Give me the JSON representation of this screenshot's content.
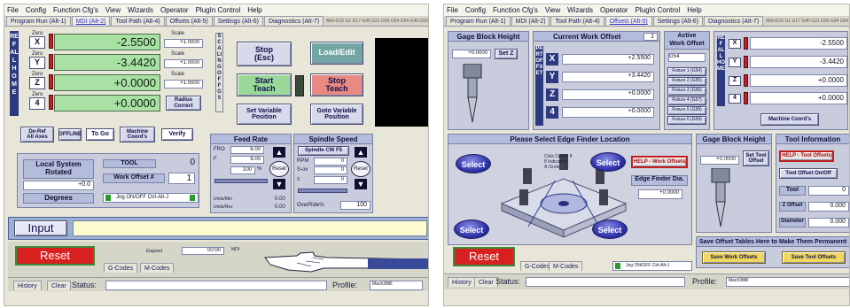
{
  "menu": [
    "File",
    "Config",
    "Function Cfg's",
    "View",
    "Wizards",
    "Operator",
    "PlugIn Control",
    "Help"
  ],
  "left": {
    "tabs": [
      "Program Run (Alt-1)",
      "MDI (Alt-2)",
      "Tool Path (Alt-4)",
      "Offsets (Alt-5)",
      "Settings (Alt-6)",
      "Diagnostics (Alt-7)"
    ],
    "tab_info": "Mill>G15 G1 G17 G40 G21 G90 G94 G54 G49 G99 G64 G97",
    "ref_all_home": "REF ALL HOME",
    "axes": [
      {
        "btn": "X",
        "value": "-2.5500",
        "scale_label": "Scale",
        "scale_value": "+1.0000"
      },
      {
        "btn": "Y",
        "value": "-3.4420",
        "scale_label": "Scale",
        "scale_value": "+1.0000"
      },
      {
        "btn": "Z",
        "value": "+0.0000",
        "scale_label": "Scale",
        "scale_value": "+1.0000"
      },
      {
        "btn": "4",
        "value": "+0.0000",
        "scale_label": "Radius",
        "scale_value": "Correct"
      }
    ],
    "zero_label": "Zero",
    "scaling_offs": "SCALING OFF G5",
    "stop": "Stop\n(Esc)",
    "load_edit": "Load/Edit",
    "start_teach": "Start\nTeach",
    "stop_teach": "Stop\nTeach",
    "set_variable_position": "Set Variable\nPosition",
    "goto_variable_position": "Goto Variable\nPosition",
    "de_ref": "De-Ref\nAll Axes",
    "offline": "OFFLINE",
    "to_go": "To Go",
    "machine_coords": "Machine\nCoord's",
    "verify": "Verify",
    "local_system_rotated": "Local System\nRotated",
    "rotated_value": "+0.0",
    "degrees": "Degrees",
    "tool_label": "TOOL",
    "tool_value": "0",
    "work_offset_label": "Work Offset #",
    "work_offset_value": "1",
    "jog_toggle": "Jog ON/OFF Ctrl-Alt-J",
    "feed_rate_title": "Feed Rate",
    "fro_label": "FRO",
    "fro_value": "6.00",
    "f_label": "F",
    "f_value": "6.00",
    "fro_percent": "100",
    "reset_small": "Reset",
    "units_min": "Units/Min",
    "units_min_value": "0.00",
    "units_rev": "Units/Rev",
    "units_rev_value": "0.00",
    "spindle_speed_title": "Spindle Speed",
    "spindle_cw": "Spindle CW F5",
    "rpm_label": "RPM",
    "rpm_value": "0",
    "sov_label": "S-ov",
    "sov_value": "0",
    "spindle_speed_label": "Spindle Speed",
    "spindle_speed_value": "0",
    "overide_label": "OverRide%",
    "overide_value": "100",
    "input_label": "Input",
    "reset": "Reset",
    "gcodes": "G-Codes",
    "mcodes": "M-Codes",
    "elapsed_label": "Elapsed",
    "elapsed_value": "00:00",
    "mdi_label": "MDI",
    "history": "History",
    "clear": "Clear",
    "status_label": "Status:",
    "profile_label": "Profile:",
    "profile_value": "Mach3Mill"
  },
  "right": {
    "tabs": [
      "Program Run (Alt-1)",
      "MDI (Alt-2)",
      "Tool Path (Alt-4)",
      "Offsets (Alt-5)",
      "Settings (Alt-6)",
      "Diagnostics (Alt-7)"
    ],
    "tab_info": "Mill>G15 G1 G17 G40 G21 G90 G94 G54 G49 G99 G64 G97",
    "gage_block_height": "Gage Block Height",
    "gage_value": "+0.0000",
    "set_z": "Set Z",
    "current_work_offset": "Current Work Offset",
    "current_work_offset_value": "1",
    "part_offset": "PART OFFSET",
    "offset_axes": [
      {
        "letter": "X",
        "value": "+2.5500"
      },
      {
        "letter": "Y",
        "value": "+3.4420"
      },
      {
        "letter": "Z",
        "value": "+0.0000"
      },
      {
        "letter": "4",
        "value": "+0.0000"
      }
    ],
    "active_work_offset": "Active\nWork Offset",
    "active_value": "G54",
    "fixtures": [
      "Fixture 1 (G54)",
      "Fixture 2 (G55)",
      "Fixture 3 (G56)",
      "Fixture 4 (G57)",
      "Fixture 5 (G58)",
      "Fixture 6 (G59)"
    ],
    "ref_all_home": "REF ALL HOME",
    "machine_axes": [
      {
        "btn": "X",
        "value": "-2.5500"
      },
      {
        "btn": "Y",
        "value": "-3.4420"
      },
      {
        "btn": "Z",
        "value": "+0.0000"
      },
      {
        "btn": "4",
        "value": "+0.0000"
      }
    ],
    "machine_coords": "Machine Coord's",
    "edge_finder_title": "Please Select Edge Finder Location",
    "select": "Select",
    "click_center": "Click Center If\nIf Indicating\nA Circle",
    "help_work_offsets": "HELP - Work Offsets",
    "edge_finder_dia": "Edge Finder Dia.",
    "edge_finder_dia_value": "+0.0000",
    "gage_block_height_2": "Gage Block Height",
    "gage_value_2": "+0.0000",
    "set_tool_offset": "Set Tool\nOffset",
    "tool_information": "Tool Information",
    "help_tool_offsets": "HELP - Tool Offsets",
    "tool_offset_onoff": "Tool Offset On/Off",
    "tool_label": "Tool",
    "tool_value": "0",
    "z_offset_label": "Z Offset",
    "z_offset_value": "0.000",
    "diameter_label": "Diameter",
    "diameter_value": "0.000",
    "save_offset_tables": "Save Offset Tables Here to Make Them Permanent",
    "save_work_offsets": "Save Work Offsets",
    "save_tool_offsets": "Save Tool Offsets",
    "reset": "Reset",
    "gcodes": "G-Codes",
    "mcodes": "M-Codes",
    "jog_toggle": "Jog ON/OFF Ctrl-Alt-J",
    "history": "History",
    "clear": "Clear",
    "status_label": "Status:",
    "profile_label": "Profile:",
    "profile_value": "Mach3Mill"
  },
  "colors": {
    "dro_green": "#a9e0a4",
    "reset_red": "#d82020",
    "panel_blue": "#c8ccdc",
    "select_blue": "#3034a8"
  }
}
